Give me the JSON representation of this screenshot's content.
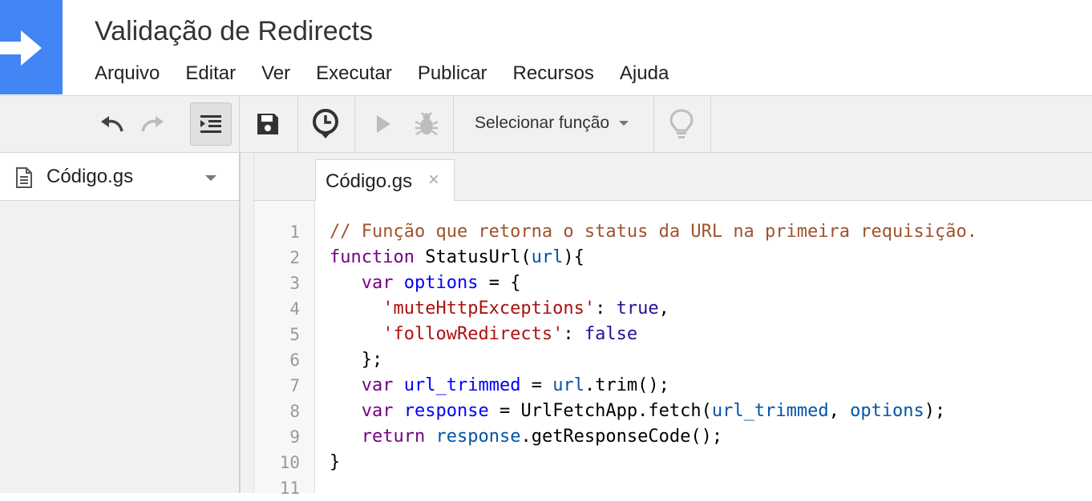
{
  "app": {
    "title": "Validação de Redirects",
    "menu": [
      "Arquivo",
      "Editar",
      "Ver",
      "Executar",
      "Publicar",
      "Recursos",
      "Ajuda"
    ]
  },
  "toolbar": {
    "function_select": "Selecionar função",
    "icons": [
      "undo-icon",
      "redo-icon",
      "indent-icon",
      "save-icon",
      "timer-icon",
      "run-icon",
      "debug-icon",
      "lightbulb-icon"
    ]
  },
  "sidebar": {
    "file_name": "Código.gs"
  },
  "editor": {
    "tab_label": "Código.gs",
    "tab_close": "×",
    "line_numbers": [
      "1",
      "2",
      "3",
      "4",
      "5",
      "6",
      "7",
      "8",
      "9",
      "10",
      "11"
    ],
    "lines": [
      [
        {
          "t": "comment",
          "v": "// Função que retorna o status da URL na primeira requisição."
        }
      ],
      [
        {
          "t": "keyword",
          "v": "function"
        },
        {
          "t": "plain",
          "v": " StatusUrl("
        },
        {
          "t": "var2",
          "v": "url"
        },
        {
          "t": "plain",
          "v": "){"
        }
      ],
      [
        {
          "t": "plain",
          "v": "   "
        },
        {
          "t": "keyword",
          "v": "var"
        },
        {
          "t": "plain",
          "v": " "
        },
        {
          "t": "def",
          "v": "options"
        },
        {
          "t": "plain",
          "v": " = {"
        }
      ],
      [
        {
          "t": "plain",
          "v": "     "
        },
        {
          "t": "string",
          "v": "'muteHttpExceptions'"
        },
        {
          "t": "plain",
          "v": ": "
        },
        {
          "t": "atom",
          "v": "true"
        },
        {
          "t": "plain",
          "v": ","
        }
      ],
      [
        {
          "t": "plain",
          "v": "     "
        },
        {
          "t": "string",
          "v": "'followRedirects'"
        },
        {
          "t": "plain",
          "v": ": "
        },
        {
          "t": "atom",
          "v": "false"
        }
      ],
      [
        {
          "t": "plain",
          "v": "   };"
        }
      ],
      [
        {
          "t": "plain",
          "v": "   "
        },
        {
          "t": "keyword",
          "v": "var"
        },
        {
          "t": "plain",
          "v": " "
        },
        {
          "t": "def",
          "v": "url_trimmed"
        },
        {
          "t": "plain",
          "v": " = "
        },
        {
          "t": "var2",
          "v": "url"
        },
        {
          "t": "plain",
          "v": ".trim();"
        }
      ],
      [
        {
          "t": "plain",
          "v": "   "
        },
        {
          "t": "keyword",
          "v": "var"
        },
        {
          "t": "plain",
          "v": " "
        },
        {
          "t": "def",
          "v": "response"
        },
        {
          "t": "plain",
          "v": " = UrlFetchApp.fetch("
        },
        {
          "t": "var2",
          "v": "url_trimmed"
        },
        {
          "t": "plain",
          "v": ", "
        },
        {
          "t": "var2",
          "v": "options"
        },
        {
          "t": "plain",
          "v": ");"
        }
      ],
      [
        {
          "t": "plain",
          "v": "   "
        },
        {
          "t": "keyword",
          "v": "return"
        },
        {
          "t": "plain",
          "v": " "
        },
        {
          "t": "var2",
          "v": "response"
        },
        {
          "t": "plain",
          "v": ".getResponseCode();"
        }
      ],
      [
        {
          "t": "plain",
          "v": "}"
        }
      ],
      []
    ]
  },
  "colors": {
    "brand_blue": "#4285f4",
    "comment": "#a0522d",
    "keyword": "#770088",
    "def": "#0000ff",
    "variable": "#0055aa",
    "string": "#aa1111",
    "atom": "#221199"
  }
}
